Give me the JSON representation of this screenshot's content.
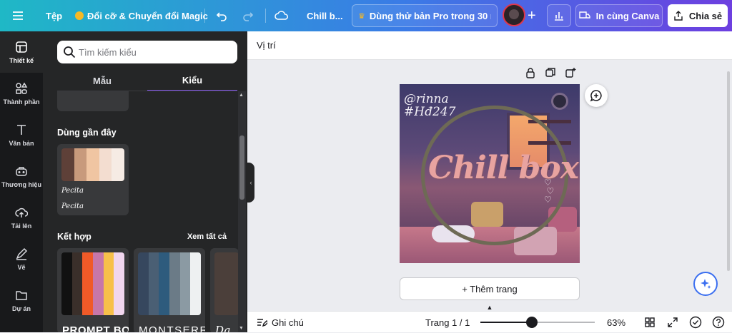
{
  "topbar": {
    "file": "Tệp",
    "resize": "Đổi cỡ & Chuyển đổi Magic",
    "doc_title": "Chill b...",
    "pro_trial": "Dùng thử bản Pro trong 30 n...",
    "print": "In cùng Canva",
    "share": "Chia sẻ"
  },
  "rail": {
    "items": [
      {
        "label": "Thiết kế",
        "icon": "design-icon"
      },
      {
        "label": "Thành phần",
        "icon": "elements-icon"
      },
      {
        "label": "Văn bản",
        "icon": "text-icon"
      },
      {
        "label": "Thương hiệu",
        "icon": "brand-icon"
      },
      {
        "label": "Tải lên",
        "icon": "upload-icon"
      },
      {
        "label": "Vẽ",
        "icon": "draw-icon"
      },
      {
        "label": "Dự án",
        "icon": "projects-icon"
      }
    ]
  },
  "panel": {
    "search_placeholder": "Tìm kiếm kiểu",
    "tab_templates": "Mẫu",
    "tab_styles": "Kiểu",
    "recent_title": "Dùng gần đây",
    "recent_font_heading": "Pecita",
    "recent_font_body": "Pecita",
    "combo_title": "Kết hợp",
    "see_all": "Xem tất cả",
    "combo_fonts": [
      "PROMPT BOLD",
      "MONTSERRAT",
      "Da"
    ],
    "recent_colors": [
      "#5e4038",
      "#c89a7c",
      "#f0c5a2",
      "#f3ddd0",
      "#f6ebe4"
    ],
    "combo_colors_1": [
      "#111111",
      "#3a2f2a",
      "#f05a28",
      "#c777a9",
      "#f7c04a",
      "#f1d6ef"
    ],
    "combo_colors_2": [
      "#36475e",
      "#4a5f74",
      "#2e5b7d",
      "#6b7b87",
      "#8b9aa3",
      "#eef0f1"
    ]
  },
  "context": {
    "position": "Vị trí"
  },
  "canvas": {
    "handle": "@rinna",
    "tag": "#Hđ247",
    "title": "Chill box"
  },
  "add_page": "+ Thêm trang",
  "bottombar": {
    "notes": "Ghi chú",
    "page": "Trang 1 / 1",
    "zoom": "63%",
    "zoom_level": 0.45
  },
  "colors": {
    "accent": "#8b5cf6",
    "rail_bg": "#18191b",
    "panel_bg": "#252627"
  }
}
